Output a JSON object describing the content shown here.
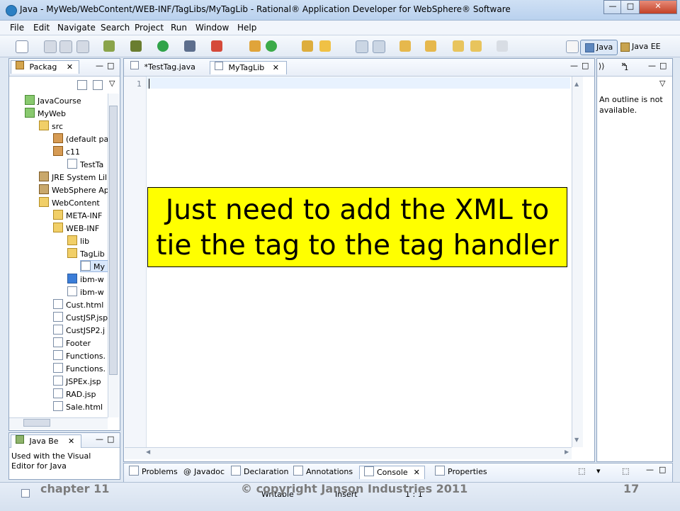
{
  "window": {
    "title": "Java - MyWeb/WebContent/WEB-INF/TagLibs/MyTagLib - Rational® Application Developer for WebSphere® Software",
    "buttons": [
      "—",
      "□",
      "✕"
    ]
  },
  "menu": [
    "File",
    "Edit",
    "Navigate",
    "Search",
    "Project",
    "Run",
    "Window",
    "Help"
  ],
  "perspectives": [
    "Java",
    "Java EE"
  ],
  "package_explorer": {
    "tab_label": "Packag",
    "items": [
      "JavaCourse",
      "MyWeb",
      "src",
      "(default pa",
      "c11",
      "TestTa",
      "JRE System Lil",
      "WebSphere Ap",
      "WebContent",
      "META-INF",
      "WEB-INF",
      "lib",
      "TagLib",
      "My",
      "ibm-w",
      "ibm-w",
      "Cust.html",
      "CustJSP.jsp",
      "CustJSP2.j",
      "Footer",
      "Functions.",
      "Functions.",
      "JSPEx.jsp",
      "RAD.jsp",
      "Sale.html"
    ]
  },
  "java_beans": {
    "tab_label": "Java Be",
    "message": "Used with the Visual Editor for Java"
  },
  "editor": {
    "tabs": [
      "*TestTag.java",
      "MyTagLib"
    ],
    "line_number": "1"
  },
  "outline": {
    "overflow_count": "1",
    "message": "An outline is not available."
  },
  "callout": {
    "line1": "Just need to add the XML to",
    "line2": "tie the tag to the tag handler"
  },
  "bottom_tabs": [
    "Problems",
    "Javadoc",
    "Declaration",
    "Annotations",
    "Console",
    "Properties"
  ],
  "status": {
    "writable": "Writable",
    "insert": "Insert",
    "position": "1 : 1"
  },
  "footer": {
    "chapter": "chapter 11",
    "copyright": "© copyright Janson Industries 2011",
    "page": "17"
  }
}
